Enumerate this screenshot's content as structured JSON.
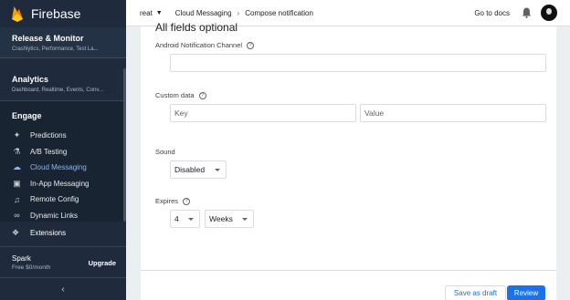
{
  "sidebar": {
    "brand": "Firebase",
    "release": {
      "title": "Release & Monitor",
      "sub": "Crashlytics, Performance, Test La..."
    },
    "analytics": {
      "title": "Analytics",
      "sub": "Dashboard, Realtime, Events, Conv..."
    },
    "engage": {
      "title": "Engage",
      "items": [
        {
          "label": "Predictions",
          "icon": "wand-icon"
        },
        {
          "label": "A/B Testing",
          "icon": "flask-icon"
        },
        {
          "label": "Cloud Messaging",
          "icon": "cloud-icon",
          "active": true
        },
        {
          "label": "In-App Messaging",
          "icon": "inapp-message-icon"
        },
        {
          "label": "Remote Config",
          "icon": "remote-config-icon"
        },
        {
          "label": "Dynamic Links",
          "icon": "link-icon"
        }
      ]
    },
    "extensions": "Extensions",
    "plan": {
      "name": "Spark",
      "price": "Free $0/month",
      "upgrade": "Upgrade"
    }
  },
  "header": {
    "project": "reat",
    "breadcrumb": [
      "Cloud Messaging",
      "Compose notification"
    ],
    "docs": "Go to docs"
  },
  "form": {
    "title": "All fields optional",
    "channel_label": "Android Notification Channel",
    "channel_value": "",
    "custom_data_label": "Custom data",
    "key_placeholder": "Key",
    "value_placeholder": "Value",
    "sound_label": "Sound",
    "sound_value": "Disabled",
    "expires_label": "Expires",
    "expires_number": "4",
    "expires_unit": "Weeks"
  },
  "actions": {
    "draft": "Save as draft",
    "review": "Review"
  },
  "colors": {
    "sidebar": "#1f2b3c",
    "accent": "#1a73e8",
    "active_nav": "#8ab4f8"
  }
}
